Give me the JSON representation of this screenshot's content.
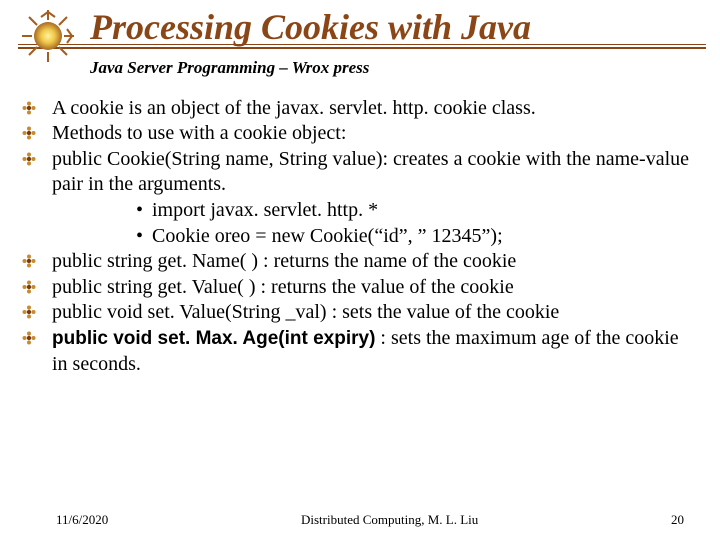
{
  "header": {
    "title": "Processing Cookies with Java",
    "subtitle": "Java Server Programming – Wrox press"
  },
  "bullets": [
    {
      "text": "A cookie is an object of the javax. servlet. http. cookie class."
    },
    {
      "text": "Methods to use with a cookie object:"
    },
    {
      "text": "public Cookie(String name, String value): creates a cookie with the name-value pair in the arguments.",
      "sub": [
        "import javax. servlet. http. *",
        "Cookie oreo = new Cookie(“id”, ” 12345”);"
      ]
    },
    {
      "text": "public string get. Name( ) : returns the name of the cookie"
    },
    {
      "text": "public string get. Value( ) : returns the value of the cookie"
    },
    {
      "text": "public void set. Value(String _val) : sets the value of the cookie"
    },
    {
      "arial_lead": "public void set. Max. Age(int expiry)",
      "tail": " : sets the maximum age of the cookie in seconds."
    }
  ],
  "footer": {
    "date": "11/6/2020",
    "center": "Distributed Computing, M. L. Liu",
    "page": "20"
  }
}
